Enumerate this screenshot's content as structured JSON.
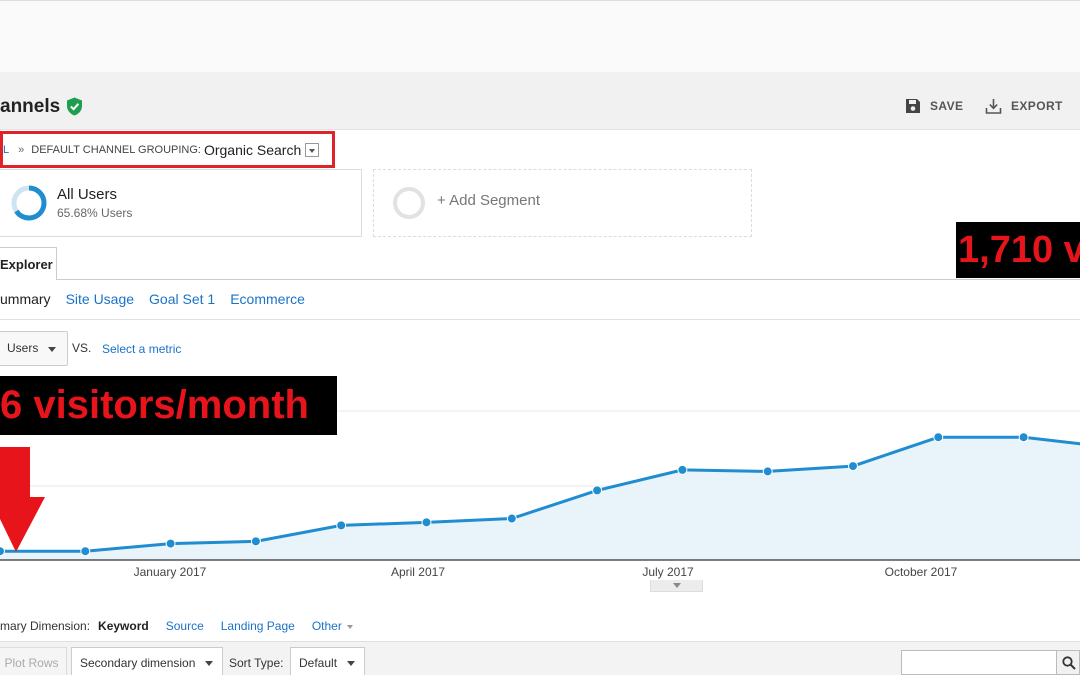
{
  "header": {
    "page_title": "annels",
    "save_label": "SAVE",
    "export_label": "EXPORT"
  },
  "breadcrumb": {
    "first": "L",
    "separator": "»",
    "grouping_label": "DEFAULT CHANNEL GROUPING:",
    "grouping_value": "Organic Search"
  },
  "segments": {
    "active": {
      "name": "All Users",
      "share": "65.68% Users"
    },
    "add_label": "+ Add Segment"
  },
  "annotations": {
    "left": "6 visitors/month",
    "right": "1,710 v"
  },
  "tabs": {
    "explorer": "Explorer",
    "subtabs": [
      "ummary",
      "Site Usage",
      "Goal Set 1",
      "Ecommerce"
    ]
  },
  "metric": {
    "selected": "Users",
    "vs": "VS.",
    "select_metric": "Select a metric"
  },
  "dimensions": {
    "label": "mary Dimension:",
    "active": "Keyword",
    "others": [
      "Source",
      "Landing Page"
    ],
    "other_label": "Other"
  },
  "table_controls": {
    "plot_rows": "Plot Rows",
    "secondary_dimension": "Secondary dimension",
    "sort_type_label": "Sort Type:",
    "sort_type_value": "Default"
  },
  "colors": {
    "line": "#1f8dd0",
    "fill": "#e8f3fa",
    "highlight": "#e0222b",
    "link": "#1a73c8",
    "verified": "#1e9e4f"
  },
  "chart_data": {
    "type": "area",
    "series": [
      {
        "values": [
          5,
          5,
          15,
          18,
          39,
          43,
          48,
          85,
          112,
          110,
          117,
          155,
          155,
          142
        ]
      }
    ],
    "x_ticks": [
      "January 2017",
      "April 2017",
      "July 2017",
      "October 2017"
    ],
    "grid": true
  }
}
